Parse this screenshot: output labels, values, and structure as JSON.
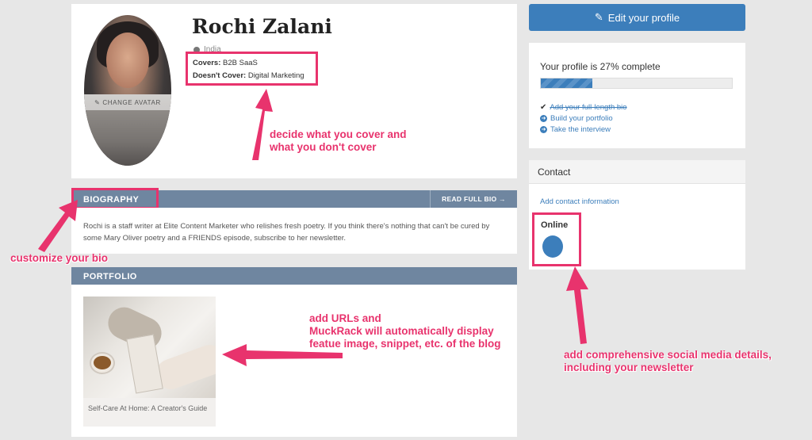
{
  "profile": {
    "name": "Rochi Zalani",
    "location": "India",
    "avatar_action": "CHANGE AVATAR",
    "covers_label": "Covers:",
    "covers_value": "B2B SaaS",
    "doesnt_cover_label": "Doesn't Cover:",
    "doesnt_cover_value": "Digital Marketing"
  },
  "biography": {
    "title": "BIOGRAPHY",
    "read_full": "READ FULL BIO →",
    "text": "Rochi is a staff writer at Elite Content Marketer who relishes fresh poetry. If you think there's nothing that can't be cured by some Mary Oliver poetry and a FRIENDS episode, subscribe to her newsletter."
  },
  "portfolio": {
    "title": "PORTFOLIO",
    "items": [
      {
        "caption": "Self-Care At Home: A Creator's Guide"
      }
    ]
  },
  "sidebar": {
    "edit_button": "Edit your profile",
    "completion": {
      "title": "Your profile is 27% complete",
      "percent": 27,
      "tasks": [
        {
          "label": "Add your full-length bio",
          "done": true
        },
        {
          "label": "Build your portfolio",
          "done": false
        },
        {
          "label": "Take the interview",
          "done": false
        }
      ]
    },
    "contact": {
      "title": "Contact",
      "add_link": "Add contact information",
      "online_label": "Online"
    }
  },
  "annotations": {
    "cover": [
      "decide what you cover and",
      "what you don't cover"
    ],
    "bio": "customize your bio",
    "urls": [
      "add URLs and",
      "MuckRack will automatically display",
      "featue image, snippet, etc. of the blog"
    ],
    "social": [
      "add comprehensive social media details,",
      "including your newsletter"
    ]
  },
  "colors": {
    "accent": "#3c7ebb",
    "section_bar": "#6f86a0",
    "annotation": "#e8336d"
  }
}
